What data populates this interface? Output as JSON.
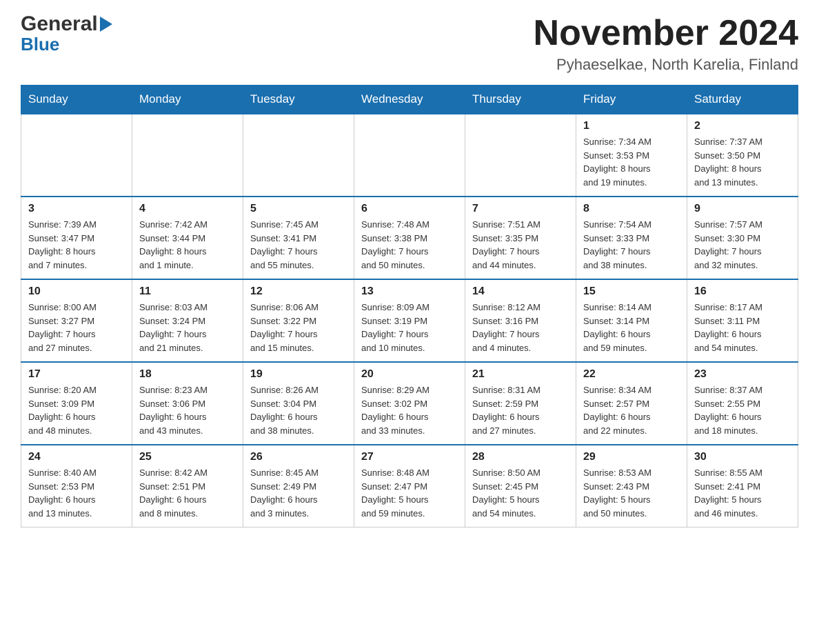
{
  "header": {
    "logo_top": "General",
    "logo_bottom": "Blue",
    "main_title": "November 2024",
    "subtitle": "Pyhaeselkae, North Karelia, Finland"
  },
  "calendar": {
    "days_of_week": [
      "Sunday",
      "Monday",
      "Tuesday",
      "Wednesday",
      "Thursday",
      "Friday",
      "Saturday"
    ],
    "weeks": [
      [
        {
          "day": "",
          "info": ""
        },
        {
          "day": "",
          "info": ""
        },
        {
          "day": "",
          "info": ""
        },
        {
          "day": "",
          "info": ""
        },
        {
          "day": "",
          "info": ""
        },
        {
          "day": "1",
          "info": "Sunrise: 7:34 AM\nSunset: 3:53 PM\nDaylight: 8 hours\nand 19 minutes."
        },
        {
          "day": "2",
          "info": "Sunrise: 7:37 AM\nSunset: 3:50 PM\nDaylight: 8 hours\nand 13 minutes."
        }
      ],
      [
        {
          "day": "3",
          "info": "Sunrise: 7:39 AM\nSunset: 3:47 PM\nDaylight: 8 hours\nand 7 minutes."
        },
        {
          "day": "4",
          "info": "Sunrise: 7:42 AM\nSunset: 3:44 PM\nDaylight: 8 hours\nand 1 minute."
        },
        {
          "day": "5",
          "info": "Sunrise: 7:45 AM\nSunset: 3:41 PM\nDaylight: 7 hours\nand 55 minutes."
        },
        {
          "day": "6",
          "info": "Sunrise: 7:48 AM\nSunset: 3:38 PM\nDaylight: 7 hours\nand 50 minutes."
        },
        {
          "day": "7",
          "info": "Sunrise: 7:51 AM\nSunset: 3:35 PM\nDaylight: 7 hours\nand 44 minutes."
        },
        {
          "day": "8",
          "info": "Sunrise: 7:54 AM\nSunset: 3:33 PM\nDaylight: 7 hours\nand 38 minutes."
        },
        {
          "day": "9",
          "info": "Sunrise: 7:57 AM\nSunset: 3:30 PM\nDaylight: 7 hours\nand 32 minutes."
        }
      ],
      [
        {
          "day": "10",
          "info": "Sunrise: 8:00 AM\nSunset: 3:27 PM\nDaylight: 7 hours\nand 27 minutes."
        },
        {
          "day": "11",
          "info": "Sunrise: 8:03 AM\nSunset: 3:24 PM\nDaylight: 7 hours\nand 21 minutes."
        },
        {
          "day": "12",
          "info": "Sunrise: 8:06 AM\nSunset: 3:22 PM\nDaylight: 7 hours\nand 15 minutes."
        },
        {
          "day": "13",
          "info": "Sunrise: 8:09 AM\nSunset: 3:19 PM\nDaylight: 7 hours\nand 10 minutes."
        },
        {
          "day": "14",
          "info": "Sunrise: 8:12 AM\nSunset: 3:16 PM\nDaylight: 7 hours\nand 4 minutes."
        },
        {
          "day": "15",
          "info": "Sunrise: 8:14 AM\nSunset: 3:14 PM\nDaylight: 6 hours\nand 59 minutes."
        },
        {
          "day": "16",
          "info": "Sunrise: 8:17 AM\nSunset: 3:11 PM\nDaylight: 6 hours\nand 54 minutes."
        }
      ],
      [
        {
          "day": "17",
          "info": "Sunrise: 8:20 AM\nSunset: 3:09 PM\nDaylight: 6 hours\nand 48 minutes."
        },
        {
          "day": "18",
          "info": "Sunrise: 8:23 AM\nSunset: 3:06 PM\nDaylight: 6 hours\nand 43 minutes."
        },
        {
          "day": "19",
          "info": "Sunrise: 8:26 AM\nSunset: 3:04 PM\nDaylight: 6 hours\nand 38 minutes."
        },
        {
          "day": "20",
          "info": "Sunrise: 8:29 AM\nSunset: 3:02 PM\nDaylight: 6 hours\nand 33 minutes."
        },
        {
          "day": "21",
          "info": "Sunrise: 8:31 AM\nSunset: 2:59 PM\nDaylight: 6 hours\nand 27 minutes."
        },
        {
          "day": "22",
          "info": "Sunrise: 8:34 AM\nSunset: 2:57 PM\nDaylight: 6 hours\nand 22 minutes."
        },
        {
          "day": "23",
          "info": "Sunrise: 8:37 AM\nSunset: 2:55 PM\nDaylight: 6 hours\nand 18 minutes."
        }
      ],
      [
        {
          "day": "24",
          "info": "Sunrise: 8:40 AM\nSunset: 2:53 PM\nDaylight: 6 hours\nand 13 minutes."
        },
        {
          "day": "25",
          "info": "Sunrise: 8:42 AM\nSunset: 2:51 PM\nDaylight: 6 hours\nand 8 minutes."
        },
        {
          "day": "26",
          "info": "Sunrise: 8:45 AM\nSunset: 2:49 PM\nDaylight: 6 hours\nand 3 minutes."
        },
        {
          "day": "27",
          "info": "Sunrise: 8:48 AM\nSunset: 2:47 PM\nDaylight: 5 hours\nand 59 minutes."
        },
        {
          "day": "28",
          "info": "Sunrise: 8:50 AM\nSunset: 2:45 PM\nDaylight: 5 hours\nand 54 minutes."
        },
        {
          "day": "29",
          "info": "Sunrise: 8:53 AM\nSunset: 2:43 PM\nDaylight: 5 hours\nand 50 minutes."
        },
        {
          "day": "30",
          "info": "Sunrise: 8:55 AM\nSunset: 2:41 PM\nDaylight: 5 hours\nand 46 minutes."
        }
      ]
    ]
  }
}
